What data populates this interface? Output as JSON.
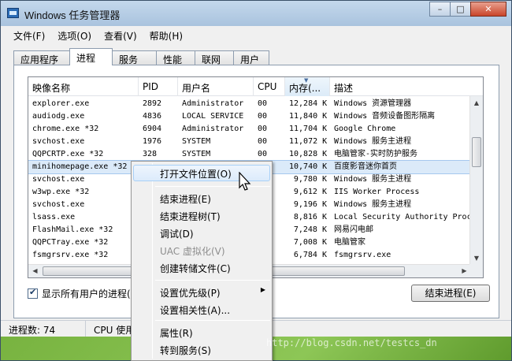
{
  "window": {
    "title": "Windows 任务管理器",
    "minimize": "–",
    "maximize": "□",
    "close": "✕"
  },
  "menu": [
    "文件(F)",
    "选项(O)",
    "查看(V)",
    "帮助(H)"
  ],
  "tabs": [
    {
      "label": "应用程序",
      "active": false
    },
    {
      "label": "进程",
      "active": true
    },
    {
      "label": "服务",
      "active": false
    },
    {
      "label": "性能",
      "active": false
    },
    {
      "label": "联网",
      "active": false
    },
    {
      "label": "用户",
      "active": false
    }
  ],
  "columns": {
    "name": "映像名称",
    "pid": "PID",
    "user": "用户名",
    "cpu": "CPU",
    "memory": "内存(...",
    "desc": "描述"
  },
  "rows": [
    {
      "name": "explorer.exe",
      "pid": "2892",
      "user": "Administrator",
      "cpu": "00",
      "mem": "12,284 K",
      "desc": "Windows 资源管理器"
    },
    {
      "name": "audiodg.exe",
      "pid": "4836",
      "user": "LOCAL SERVICE",
      "cpu": "00",
      "mem": "11,840 K",
      "desc": "Windows 音频设备图形隔离"
    },
    {
      "name": "chrome.exe *32",
      "pid": "6904",
      "user": "Administrator",
      "cpu": "00",
      "mem": "11,704 K",
      "desc": "Google Chrome"
    },
    {
      "name": "svchost.exe",
      "pid": "1976",
      "user": "SYSTEM",
      "cpu": "00",
      "mem": "11,072 K",
      "desc": "Windows 服务主进程"
    },
    {
      "name": "QQPCRTP.exe *32",
      "pid": "328",
      "user": "SYSTEM",
      "cpu": "00",
      "mem": "10,828 K",
      "desc": "电脑管家-实时防护服务"
    },
    {
      "name": "minihomepage.exe *32",
      "pid": "",
      "user": "",
      "cpu": "",
      "mem": "10,740 K",
      "desc": "百度影音迷你首页"
    },
    {
      "name": "svchost.exe",
      "pid": "",
      "user": "",
      "cpu": "",
      "mem": "9,780 K",
      "desc": "Windows 服务主进程"
    },
    {
      "name": "w3wp.exe *32",
      "pid": "",
      "user": "",
      "cpu": "",
      "mem": "9,612 K",
      "desc": "IIS Worker Process"
    },
    {
      "name": "svchost.exe",
      "pid": "",
      "user": "",
      "cpu": "",
      "mem": "9,196 K",
      "desc": "Windows 服务主进程"
    },
    {
      "name": "lsass.exe",
      "pid": "",
      "user": "",
      "cpu": "",
      "mem": "8,816 K",
      "desc": "Local Security Authority Proc"
    },
    {
      "name": "FlashMail.exe *32",
      "pid": "",
      "user": "",
      "cpu": "",
      "mem": "7,248 K",
      "desc": "网易闪电邮"
    },
    {
      "name": "QQPCTray.exe *32",
      "pid": "",
      "user": "",
      "cpu": "",
      "mem": "7,008 K",
      "desc": "电脑管家"
    },
    {
      "name": "fsmgrsrv.exe *32",
      "pid": "",
      "user": "",
      "cpu": "",
      "mem": "6,784 K",
      "desc": "fsmgrsrv.exe"
    }
  ],
  "show_all_users": "显示所有用户的进程(S",
  "end_process_button": "结束进程(E)",
  "status": {
    "process_count": "进程数: 74",
    "cpu_usage": "CPU 使用"
  },
  "context_menu": {
    "open_location": "打开文件位置(O)",
    "end_process": "结束进程(E)",
    "end_tree": "结束进程树(T)",
    "debug": "调试(D)",
    "uac": "UAC 虚拟化(V)",
    "dump": "创建转储文件(C)",
    "priority": "设置优先级(P)",
    "affinity": "设置相关性(A)...",
    "properties": "属性(R)",
    "goto_service": "转到服务(S)"
  },
  "watermark": "http://blog.csdn.net/testcs_dn"
}
